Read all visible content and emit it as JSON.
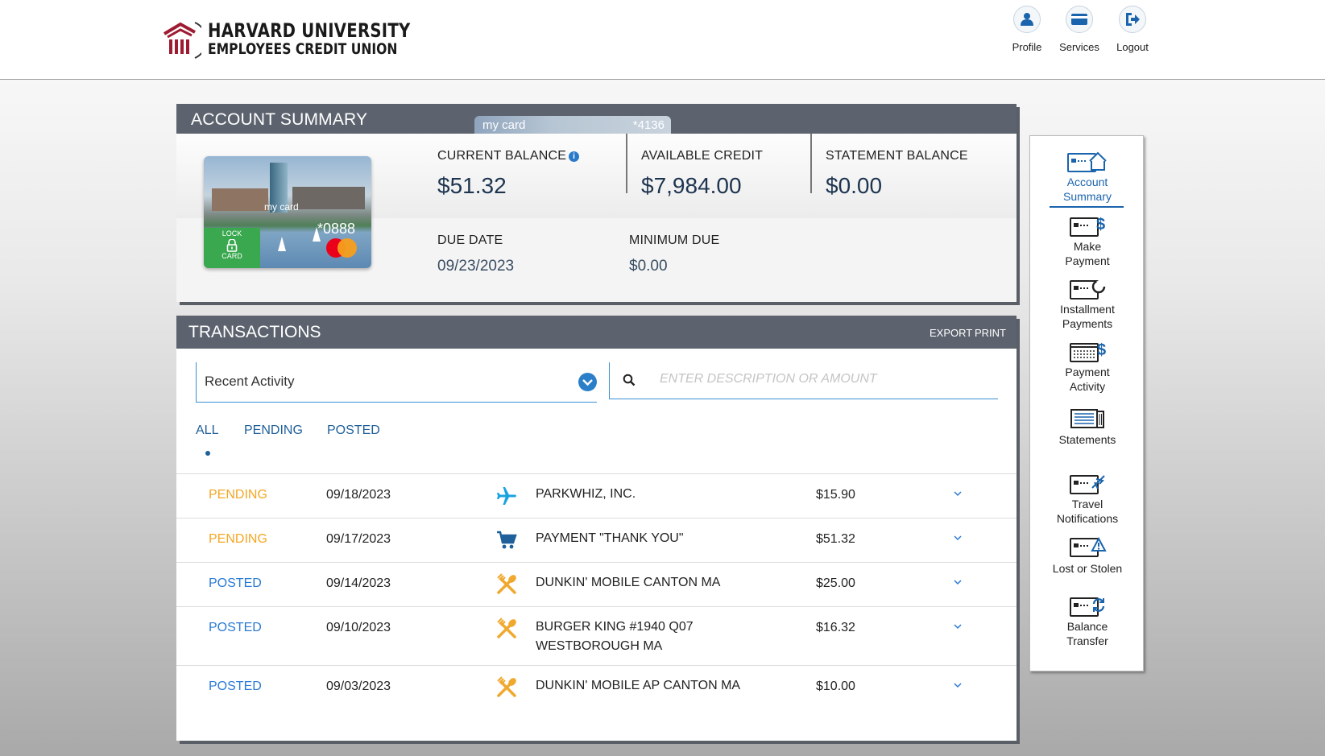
{
  "header": {
    "logo_line1": "HARVARD UNIVERSITY",
    "logo_line2": "EMPLOYEES CREDIT UNION",
    "nav": [
      {
        "label": "Profile",
        "icon": "user-icon"
      },
      {
        "label": "Services",
        "icon": "credit-card-icon"
      },
      {
        "label": "Logout",
        "icon": "logout-icon"
      }
    ]
  },
  "account_summary": {
    "title": "ACCOUNT SUMMARY",
    "tab_card": {
      "name": "my card",
      "number": "*4136"
    },
    "card": {
      "name": "my card",
      "number": "*0888",
      "lock_top": "LOCK",
      "lock_bottom": "CARD"
    },
    "current_balance_label": "CURRENT BALANCE",
    "current_balance": "$51.32",
    "available_credit_label": "AVAILABLE CREDIT",
    "available_credit": "$7,984.00",
    "statement_balance_label": "STATEMENT BALANCE",
    "statement_balance": "$0.00",
    "due_date_label": "DUE DATE",
    "due_date": "09/23/2023",
    "minimum_due_label": "MINIMUM DUE",
    "minimum_due": "$0.00"
  },
  "transactions": {
    "title": "TRANSACTIONS",
    "export": "EXPORT",
    "print": "PRINT",
    "filter_selected": "Recent Activity",
    "search_placeholder": "ENTER DESCRIPTION OR AMOUNT",
    "tabs": [
      "ALL",
      "PENDING",
      "POSTED"
    ],
    "active_tab": "ALL",
    "rows": [
      {
        "status": "PENDING",
        "date": "09/18/2023",
        "icon": "airplane-icon",
        "description": "PARKWHIZ, INC.",
        "amount": "$15.90"
      },
      {
        "status": "PENDING",
        "date": "09/17/2023",
        "icon": "shopping-cart-icon",
        "description": "PAYMENT \"THANK YOU\"",
        "amount": "$51.32"
      },
      {
        "status": "POSTED",
        "date": "09/14/2023",
        "icon": "restaurant-icon",
        "description": "DUNKIN' MOBILE CANTON MA",
        "amount": "$25.00"
      },
      {
        "status": "POSTED",
        "date": "09/10/2023",
        "icon": "restaurant-icon",
        "description": "BURGER KING #1940 Q07 WESTBOROUGH MA",
        "amount": "$16.32"
      },
      {
        "status": "POSTED",
        "date": "09/03/2023",
        "icon": "restaurant-icon",
        "description": "DUNKIN' MOBILE AP CANTON MA",
        "amount": "$10.00"
      }
    ],
    "status_colors": {
      "PENDING": "#f5a623",
      "POSTED": "#2a7ad5"
    }
  },
  "side_nav": {
    "items": [
      {
        "line1": "Account",
        "line2": "Summary",
        "icon": "account-summary-icon",
        "active": true
      },
      {
        "line1": "Make",
        "line2": "Payment",
        "icon": "make-payment-icon"
      },
      {
        "line1": "Installment",
        "line2": "Payments",
        "icon": "installment-payments-icon"
      },
      {
        "line1": "Payment",
        "line2": "Activity",
        "icon": "payment-activity-icon"
      },
      {
        "line1": "Statements",
        "line2": "",
        "icon": "statements-icon"
      },
      {
        "line1": "Travel",
        "line2": "Notifications",
        "icon": "travel-notifications-icon"
      },
      {
        "line1": "Lost or Stolen",
        "line2": "",
        "icon": "lost-stolen-icon"
      },
      {
        "line1": "Balance",
        "line2": "Transfer",
        "icon": "balance-transfer-icon"
      }
    ]
  },
  "colors": {
    "header_bar": "#5c636e",
    "accent": "#1a64ad",
    "brand": "#9e1b32"
  }
}
